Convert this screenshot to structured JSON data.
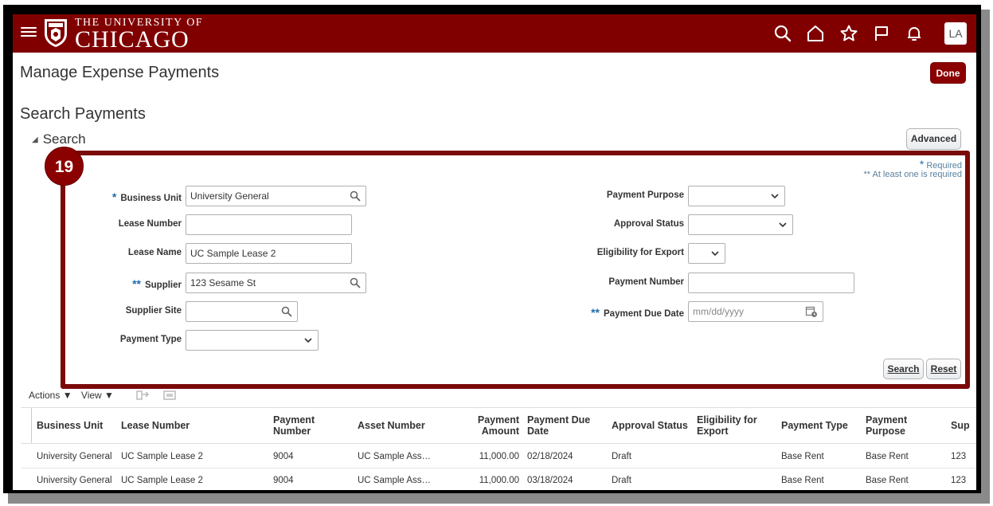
{
  "header": {
    "logo_top": "THE UNIVERSITY OF",
    "logo_main": "CHICAGO",
    "avatar": "LA",
    "icons": [
      "hamburger-icon",
      "search-icon",
      "home-icon",
      "star-icon",
      "flag-icon",
      "bell-icon"
    ],
    "brand_color": "#800000"
  },
  "page": {
    "title": "Manage Expense Payments",
    "done_label": "Done",
    "section_title": "Search Payments",
    "search_toggle": "Search",
    "advanced_label": "Advanced",
    "step_badge": "19",
    "required_note": "Required",
    "atleast_note": "** At least one is required"
  },
  "form": {
    "business_unit": {
      "label": "Business Unit",
      "value": "University General"
    },
    "lease_number": {
      "label": "Lease Number",
      "value": ""
    },
    "lease_name": {
      "label": "Lease Name",
      "value": "UC Sample Lease 2"
    },
    "supplier": {
      "label": "Supplier",
      "value": "123 Sesame St"
    },
    "supplier_site": {
      "label": "Supplier Site",
      "value": ""
    },
    "payment_type": {
      "label": "Payment Type",
      "value": ""
    },
    "payment_purpose": {
      "label": "Payment Purpose",
      "value": ""
    },
    "approval_status": {
      "label": "Approval Status",
      "value": ""
    },
    "eligibility_for_export": {
      "label": "Eligibility for Export",
      "value": ""
    },
    "payment_number": {
      "label": "Payment Number",
      "value": ""
    },
    "payment_due_date": {
      "label": "Payment Due Date",
      "placeholder": "mm/dd/yyyy"
    },
    "search_label": "Search",
    "reset_label": "Reset"
  },
  "toolbar": {
    "actions": "Actions",
    "view": "View"
  },
  "table": {
    "headers": {
      "business_unit": "Business Unit",
      "lease_number": "Lease Number",
      "payment_number_1": "Payment",
      "payment_number_2": "Number",
      "asset_number": "Asset Number",
      "payment_amount_1": "Payment",
      "payment_amount_2": "Amount",
      "payment_due_date_1": "Payment Due",
      "payment_due_date_2": "Date",
      "approval_status": "Approval Status",
      "eligibility_1": "Eligibility for",
      "eligibility_2": "Export",
      "payment_type": "Payment Type",
      "payment_purpose_1": "Payment",
      "payment_purpose_2": "Purpose",
      "supplier": "Sup"
    },
    "rows": [
      {
        "business_unit": "University General",
        "lease_number": "UC Sample Lease 2",
        "payment_number": "9004",
        "asset_number": "UC Sample Ass…",
        "amount": "11,000.00",
        "due_date": "02/18/2024",
        "status": "Draft",
        "eligibility": "",
        "type": "Base Rent",
        "purpose": "Base Rent",
        "supplier": "123"
      },
      {
        "business_unit": "University General",
        "lease_number": "UC Sample Lease 2",
        "payment_number": "9004",
        "asset_number": "UC Sample Ass…",
        "amount": "11,000.00",
        "due_date": "03/18/2024",
        "status": "Draft",
        "eligibility": "",
        "type": "Base Rent",
        "purpose": "Base Rent",
        "supplier": "123"
      }
    ]
  }
}
